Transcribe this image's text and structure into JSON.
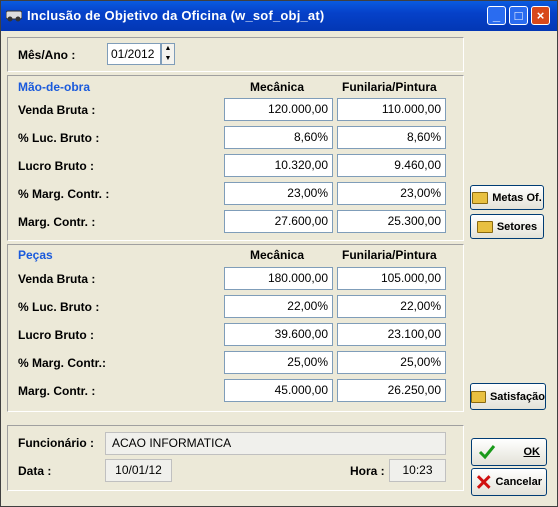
{
  "window": {
    "title": "Inclusão de Objetivo da Oficina (w_sof_obj_at)"
  },
  "period": {
    "label": "Mês/Ano :",
    "value": "01/2012"
  },
  "columns": {
    "mecanica": "Mecânica",
    "funilaria": "Funilaria/Pintura"
  },
  "mao_de_obra": {
    "title": "Mão-de-obra",
    "rows": [
      {
        "label": "Venda Bruta :",
        "mecanica": "120.000,00",
        "funilaria": "110.000,00"
      },
      {
        "label": "% Luc. Bruto :",
        "mecanica": "8,60%",
        "funilaria": "8,60%"
      },
      {
        "label": "Lucro Bruto :",
        "mecanica": "10.320,00",
        "funilaria": "9.460,00"
      },
      {
        "label": "% Marg. Contr. :",
        "mecanica": "23,00%",
        "funilaria": "23,00%"
      },
      {
        "label": "Marg. Contr. :",
        "mecanica": "27.600,00",
        "funilaria": "25.300,00"
      }
    ]
  },
  "pecas": {
    "title": "Peças",
    "rows": [
      {
        "label": "Venda Bruta :",
        "mecanica": "180.000,00",
        "funilaria": "105.000,00"
      },
      {
        "label": "% Luc. Bruto :",
        "mecanica": "22,00%",
        "funilaria": "22,00%"
      },
      {
        "label": "Lucro Bruto :",
        "mecanica": "39.600,00",
        "funilaria": "23.100,00"
      },
      {
        "label": "% Marg. Contr.:",
        "mecanica": "25,00%",
        "funilaria": "25,00%"
      },
      {
        "label": "Marg. Contr. :",
        "mecanica": "45.000,00",
        "funilaria": "26.250,00"
      }
    ]
  },
  "buttons": {
    "metas": "Metas Of.",
    "setores": "Setores",
    "satisfacao": "Satisfação",
    "ok": "OK",
    "cancelar": "Cancelar"
  },
  "footer": {
    "funcionario_label": "Funcionário :",
    "funcionario": "ACAO INFORMATICA",
    "data_label": "Data :",
    "data": "10/01/12",
    "hora_label": "Hora :",
    "hora": "10:23"
  }
}
